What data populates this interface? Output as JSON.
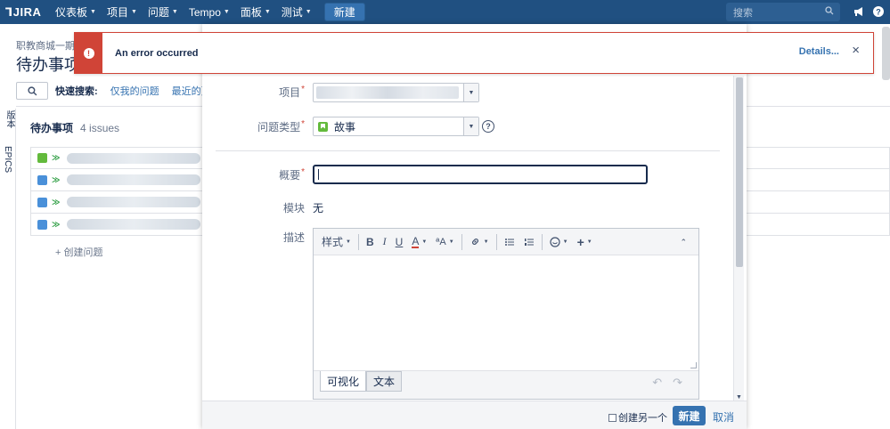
{
  "nav": {
    "logo": "JIRA",
    "items": [
      {
        "label": "仪表板"
      },
      {
        "label": "项目"
      },
      {
        "label": "问题"
      },
      {
        "label": "Tempo"
      },
      {
        "label": "面板"
      },
      {
        "label": "测试"
      }
    ],
    "create_label": "新建",
    "search_placeholder": "搜索"
  },
  "page": {
    "breadcrumb": "职教商城一期",
    "title": "待办事项",
    "quick_filter_label": "快速搜索:",
    "quick_filters": [
      "仅我的问题",
      "最近的更"
    ],
    "side_tabs": [
      "版本",
      "EPICS"
    ],
    "backlog_title": "待办事项",
    "backlog_count": "4 issues",
    "create_issue_link": "+ 创建问题"
  },
  "error": {
    "message": "An error occurred",
    "details_label": "Details...",
    "close": "×"
  },
  "modal": {
    "project_label": "项目",
    "issue_type_label": "问题类型",
    "issue_type_value": "故事",
    "summary_label": "概要",
    "summary_value": "",
    "module_label": "模块",
    "module_value": "无",
    "description_label": "描述",
    "toolbar": {
      "style": "样式",
      "bold": "B",
      "italic": "I",
      "underline": "U",
      "color": "A",
      "size": "ªA"
    },
    "tabs": [
      "可视化",
      "文本"
    ],
    "footer": {
      "create_another": "创建另一个",
      "create": "新建",
      "cancel": "取消"
    }
  },
  "colors": {
    "nav_bg": "#205081",
    "error": "#d04437",
    "primary": "#3572b0",
    "story": "#63ba3c"
  }
}
